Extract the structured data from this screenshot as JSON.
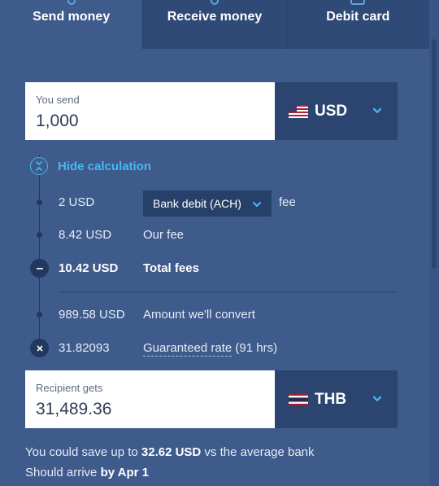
{
  "tabs": [
    {
      "label": "Send money",
      "active": true
    },
    {
      "label": "Receive money",
      "active": false
    },
    {
      "label": "Debit card",
      "active": false
    }
  ],
  "send": {
    "label": "You send",
    "value": "1,000",
    "currency": "USD",
    "flag": "us-flag-icon"
  },
  "calc": {
    "toggle_label": "Hide calculation",
    "rows": {
      "debit_fee": {
        "amount": "2 USD",
        "method": "Bank debit (ACH)",
        "suffix": "fee"
      },
      "our_fee": {
        "amount": "8.42 USD",
        "label": "Our fee"
      },
      "total": {
        "amount": "10.42 USD",
        "label": "Total fees"
      },
      "convert": {
        "amount": "989.58 USD",
        "label": "Amount we'll convert"
      },
      "rate": {
        "amount": "31.82093",
        "label": "Guaranteed rate",
        "suffix": "(91 hrs)"
      }
    }
  },
  "recipient": {
    "label": "Recipient gets",
    "value": "31,489.36",
    "currency": "THB",
    "flag": "th-flag-icon"
  },
  "footer": {
    "save_prefix": "You could save up to ",
    "save_amount": "32.62 USD",
    "save_suffix": " vs the average bank",
    "arrive_prefix": "Should arrive ",
    "arrive_date": "by Apr 1"
  },
  "colors": {
    "background": "#3e5b8c",
    "accent": "#46b8f0",
    "dark_panel": "#2b4570"
  }
}
